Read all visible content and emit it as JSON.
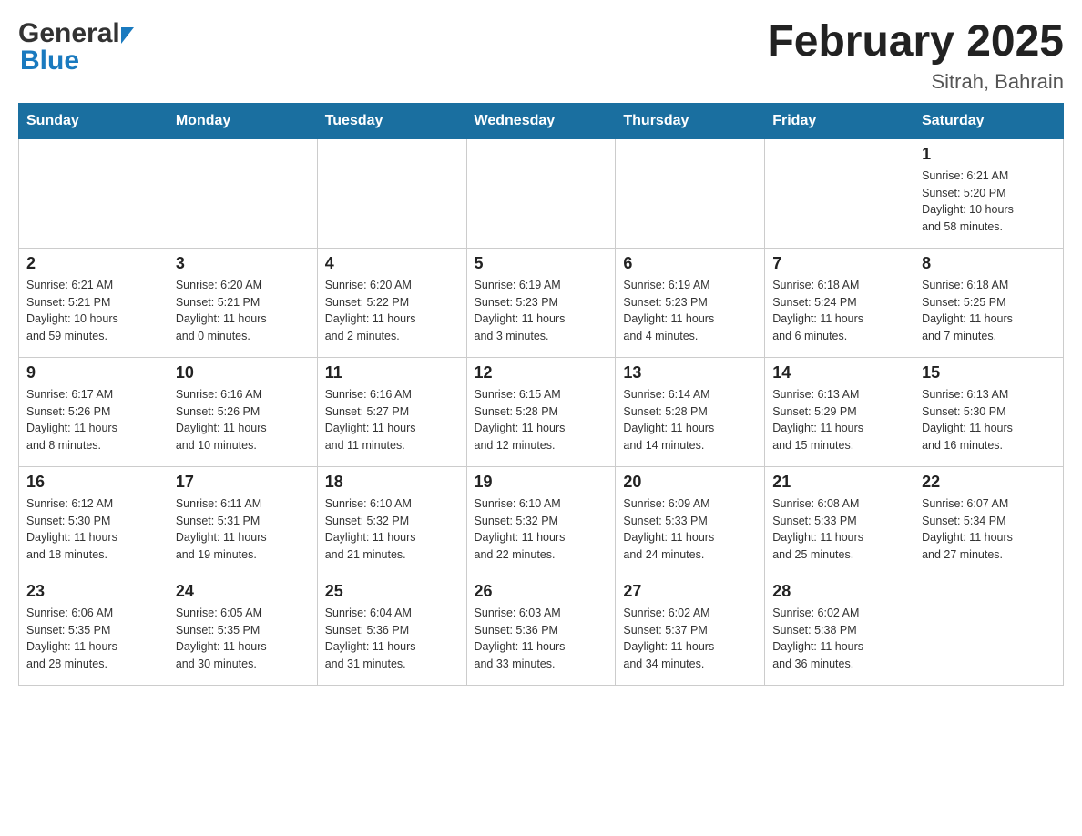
{
  "header": {
    "month_title": "February 2025",
    "location": "Sitrah, Bahrain",
    "logo_general": "General",
    "logo_blue": "Blue"
  },
  "weekdays": [
    "Sunday",
    "Monday",
    "Tuesday",
    "Wednesday",
    "Thursday",
    "Friday",
    "Saturday"
  ],
  "weeks": [
    {
      "days": [
        {
          "date": "",
          "info": ""
        },
        {
          "date": "",
          "info": ""
        },
        {
          "date": "",
          "info": ""
        },
        {
          "date": "",
          "info": ""
        },
        {
          "date": "",
          "info": ""
        },
        {
          "date": "",
          "info": ""
        },
        {
          "date": "1",
          "info": "Sunrise: 6:21 AM\nSunset: 5:20 PM\nDaylight: 10 hours\nand 58 minutes."
        }
      ]
    },
    {
      "days": [
        {
          "date": "2",
          "info": "Sunrise: 6:21 AM\nSunset: 5:21 PM\nDaylight: 10 hours\nand 59 minutes."
        },
        {
          "date": "3",
          "info": "Sunrise: 6:20 AM\nSunset: 5:21 PM\nDaylight: 11 hours\nand 0 minutes."
        },
        {
          "date": "4",
          "info": "Sunrise: 6:20 AM\nSunset: 5:22 PM\nDaylight: 11 hours\nand 2 minutes."
        },
        {
          "date": "5",
          "info": "Sunrise: 6:19 AM\nSunset: 5:23 PM\nDaylight: 11 hours\nand 3 minutes."
        },
        {
          "date": "6",
          "info": "Sunrise: 6:19 AM\nSunset: 5:23 PM\nDaylight: 11 hours\nand 4 minutes."
        },
        {
          "date": "7",
          "info": "Sunrise: 6:18 AM\nSunset: 5:24 PM\nDaylight: 11 hours\nand 6 minutes."
        },
        {
          "date": "8",
          "info": "Sunrise: 6:18 AM\nSunset: 5:25 PM\nDaylight: 11 hours\nand 7 minutes."
        }
      ]
    },
    {
      "days": [
        {
          "date": "9",
          "info": "Sunrise: 6:17 AM\nSunset: 5:26 PM\nDaylight: 11 hours\nand 8 minutes."
        },
        {
          "date": "10",
          "info": "Sunrise: 6:16 AM\nSunset: 5:26 PM\nDaylight: 11 hours\nand 10 minutes."
        },
        {
          "date": "11",
          "info": "Sunrise: 6:16 AM\nSunset: 5:27 PM\nDaylight: 11 hours\nand 11 minutes."
        },
        {
          "date": "12",
          "info": "Sunrise: 6:15 AM\nSunset: 5:28 PM\nDaylight: 11 hours\nand 12 minutes."
        },
        {
          "date": "13",
          "info": "Sunrise: 6:14 AM\nSunset: 5:28 PM\nDaylight: 11 hours\nand 14 minutes."
        },
        {
          "date": "14",
          "info": "Sunrise: 6:13 AM\nSunset: 5:29 PM\nDaylight: 11 hours\nand 15 minutes."
        },
        {
          "date": "15",
          "info": "Sunrise: 6:13 AM\nSunset: 5:30 PM\nDaylight: 11 hours\nand 16 minutes."
        }
      ]
    },
    {
      "days": [
        {
          "date": "16",
          "info": "Sunrise: 6:12 AM\nSunset: 5:30 PM\nDaylight: 11 hours\nand 18 minutes."
        },
        {
          "date": "17",
          "info": "Sunrise: 6:11 AM\nSunset: 5:31 PM\nDaylight: 11 hours\nand 19 minutes."
        },
        {
          "date": "18",
          "info": "Sunrise: 6:10 AM\nSunset: 5:32 PM\nDaylight: 11 hours\nand 21 minutes."
        },
        {
          "date": "19",
          "info": "Sunrise: 6:10 AM\nSunset: 5:32 PM\nDaylight: 11 hours\nand 22 minutes."
        },
        {
          "date": "20",
          "info": "Sunrise: 6:09 AM\nSunset: 5:33 PM\nDaylight: 11 hours\nand 24 minutes."
        },
        {
          "date": "21",
          "info": "Sunrise: 6:08 AM\nSunset: 5:33 PM\nDaylight: 11 hours\nand 25 minutes."
        },
        {
          "date": "22",
          "info": "Sunrise: 6:07 AM\nSunset: 5:34 PM\nDaylight: 11 hours\nand 27 minutes."
        }
      ]
    },
    {
      "days": [
        {
          "date": "23",
          "info": "Sunrise: 6:06 AM\nSunset: 5:35 PM\nDaylight: 11 hours\nand 28 minutes."
        },
        {
          "date": "24",
          "info": "Sunrise: 6:05 AM\nSunset: 5:35 PM\nDaylight: 11 hours\nand 30 minutes."
        },
        {
          "date": "25",
          "info": "Sunrise: 6:04 AM\nSunset: 5:36 PM\nDaylight: 11 hours\nand 31 minutes."
        },
        {
          "date": "26",
          "info": "Sunrise: 6:03 AM\nSunset: 5:36 PM\nDaylight: 11 hours\nand 33 minutes."
        },
        {
          "date": "27",
          "info": "Sunrise: 6:02 AM\nSunset: 5:37 PM\nDaylight: 11 hours\nand 34 minutes."
        },
        {
          "date": "28",
          "info": "Sunrise: 6:02 AM\nSunset: 5:38 PM\nDaylight: 11 hours\nand 36 minutes."
        },
        {
          "date": "",
          "info": ""
        }
      ]
    }
  ]
}
